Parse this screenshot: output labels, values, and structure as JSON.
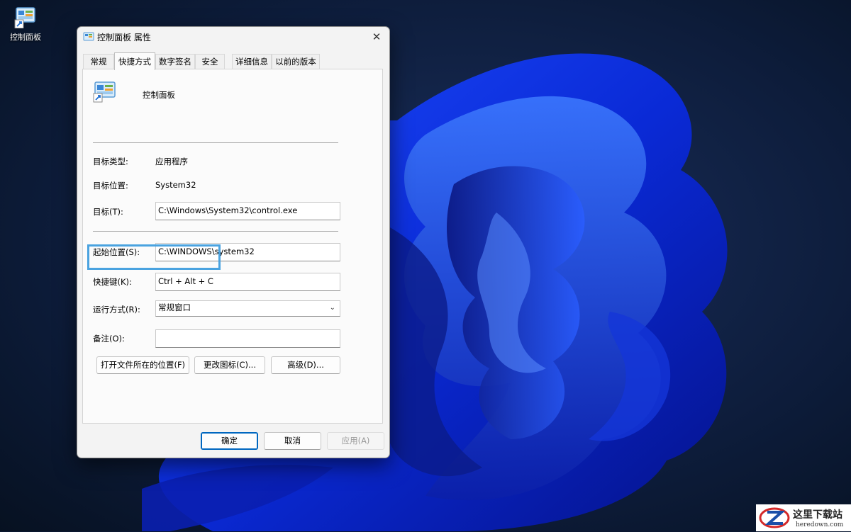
{
  "desktop": {
    "icon_label": "控制面板"
  },
  "dialog": {
    "title": "控制面板 属性",
    "tabs": [
      "常规",
      "快捷方式",
      "数字签名",
      "安全",
      "详细信息",
      "以前的版本"
    ],
    "active_tab": "快捷方式",
    "shortcut_name": "控制面板",
    "rows": {
      "target_type": {
        "label": "目标类型:",
        "value": "应用程序"
      },
      "target_location": {
        "label": "目标位置:",
        "value": "System32"
      },
      "target": {
        "label": "目标(T):",
        "value": "C:\\Windows\\System32\\control.exe"
      },
      "start_in": {
        "label": "起始位置(S):",
        "value": "C:\\WINDOWS\\system32"
      },
      "shortcut_key": {
        "label": "快捷键(K):",
        "value": "Ctrl + Alt + C"
      },
      "run": {
        "label": "运行方式(R):",
        "value": "常规窗口"
      },
      "comment": {
        "label": "备注(O):",
        "value": ""
      }
    },
    "buttons": {
      "open_location": "打开文件所在的位置(F)",
      "change_icon": "更改图标(C)...",
      "advanced": "高级(D)...",
      "ok": "确定",
      "cancel": "取消",
      "apply": "应用(A)"
    }
  },
  "watermark": {
    "name": "这里下载站",
    "url": "heredown.com"
  },
  "colors": {
    "highlight": "#4aa3e0",
    "accent": "#0067c0"
  }
}
